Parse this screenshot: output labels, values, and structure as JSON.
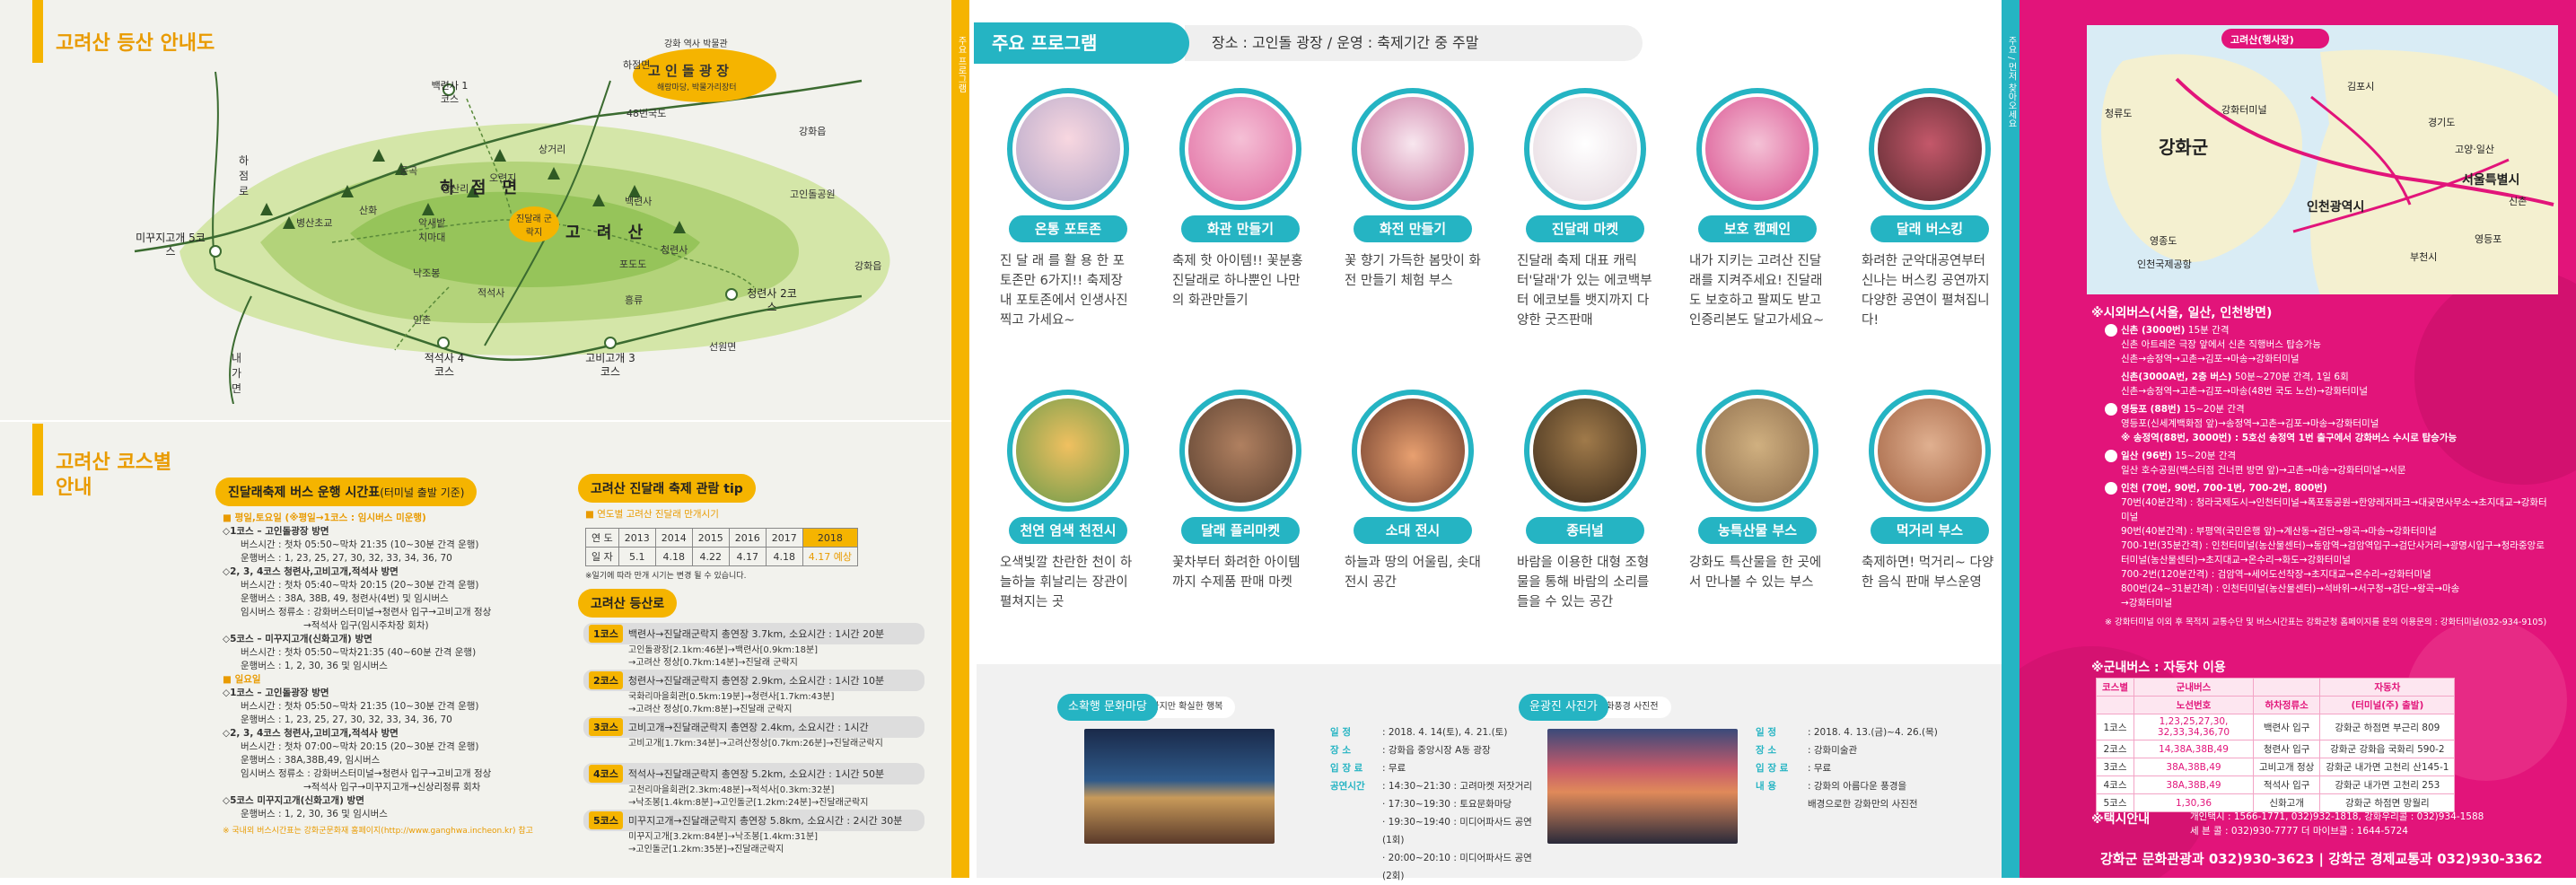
{
  "panel1": {
    "map_title": "고려산 등산 안내도",
    "course_title_l1": "고려산 코스별",
    "course_title_l2": "안내",
    "park": {
      "title": "고 인 돌  광 장",
      "sub": "해랑마당, 박물가리장터",
      "museum": "강화 역사 박물관"
    },
    "map_labels": {
      "hajeommyeon": "하 점 면",
      "goryeosan": "고 려 산",
      "azalea": "진달래 군락지",
      "hajeomro": "하점로",
      "naega": "내가면",
      "mijigogae": "미꾸지고개 5코스",
      "baengnyeonsa": "백련사 1코스",
      "cheongryeonsa": "청련사 2코스",
      "jeokseoksa": "적석사 4코스",
      "gobigogae": "고비고개 3코스",
      "hoejeongsa": "하점면",
      "r48": "48번국도",
      "ganghwaeup": "강화읍",
      "goinmool": "고인돌공원",
      "gwangwha2": "강화읍",
      "seongwon": "선원면",
      "byeongsan": "병산초교",
      "sanhwa": "산화",
      "muhak": "악새밭",
      "chido": "치마대",
      "nakjo": "낙조봉",
      "inchon": "인촌",
      "jeokseoksa2": "적석사",
      "donggok": "동곡",
      "oryeonji": "오련지",
      "sangsanri": "상산리",
      "sangga": "상거리",
      "baengnyeonsa2": "백련사",
      "cheonryeonsa": "청련사",
      "pojangdo": "포도도",
      "heungnyu": "흥류"
    },
    "bus": {
      "title": "진달래축제 버스 운행 시간표",
      "title_note": "(터미널 출발 기준)",
      "weekday": "■ 평일,토요일 (※평일→1코스 : 임시버스 미운행)",
      "c1_title": "◇1코스 – 고인돌광장 방면",
      "c1_l1": "버스시간 : 첫차 05:50~막차 21:35 (10~30분 간격 운행)",
      "c1_l2": "운행버스 : 1, 23, 25, 27, 30, 32, 33, 34, 36, 70",
      "c234_title": "◇2, 3, 4코스 청련사,고비고개,적석사 방면",
      "c234_l1": "버스시간 : 첫차 05:40~막차 20:15 (20~30분 간격 운행)",
      "c234_l2": "운행버스 : 38A, 38B, 49, 청련사(4번) 및 임시버스",
      "c234_l3": "임시버스 정류소 : 강화버스터미널→청련사 입구→고비고개 정상",
      "c234_l4": "→적석사 입구(임시주차장 회차)",
      "c5_title": "◇5코스 – 미꾸지고개(신화고개) 방면",
      "c5_l1": "버스시간 : 첫차 05:50~막차21:35 (40~60분 간격 운행)",
      "c5_l2": "운행버스 : 1, 2, 30, 36 및 임시버스",
      "sunday": "■ 일요일",
      "s1_title": "◇1코스 – 고인돌광장 방면",
      "s1_l1": "버스시간 : 첫차 05:50~막차 21:35 (10~30분 간격 운행)",
      "s1_l2": "운행버스 : 1, 23, 25, 27, 30, 32, 33, 34, 36, 70",
      "s234_title": "◇2, 3, 4코스 청련사,고비고개,적석사 방면",
      "s234_l1": "버스시간 : 첫차 07:00~막차 20:15 (20~30분 간격 운행)",
      "s234_l2": "운행버스 : 38A,38B,49, 임시버스",
      "s234_l3": "임시버스 정류소 : 강화버스터미널→청련사 입구→고비고개 정상",
      "s234_l4": "→적석사 입구→미꾸지고개→신상리정류 회차",
      "s5_title": "◇5코스 미꾸지고개(신화고개) 방면",
      "s5_l1": "운행버스 : 1, 2, 30, 36 및 임시버스",
      "note": "※ 국내외 버스시간표는 강화군문화재 홈페이지(http://www.ganghwa.incheon.kr) 참고"
    },
    "tip": {
      "title": "고려산 진달래 축제 관람 tip",
      "sub": "■ 연도별 고려산 진달래 만개시기",
      "header": [
        "연 도",
        "2013",
        "2014",
        "2015",
        "2016",
        "2017",
        "2018"
      ],
      "row": [
        "일 자",
        "5.1",
        "4.18",
        "4.22",
        "4.17",
        "4.18",
        "4.17 예상"
      ],
      "note": "※일기에 따라 만개 시기는 변경 될 수 있습니다."
    },
    "hike": {
      "title": "고려산 등산로",
      "courses": [
        {
          "idx": "1코스",
          "head": "백련사→진달래군락지 총연장 3.7km, 소요시간 : 1시간 20분",
          "d1": "고인돌광장[2.1km:46분]→백련사[0.9km:18분]",
          "d2": "→고려산 정상[0.7km:14분]→진달래 군락지"
        },
        {
          "idx": "2코스",
          "head": "청련사→진달래군락지 총연장 2.9km, 소요시간 : 1시간 10분",
          "d1": "국화리마을회관[0.5km:19분]→청련사[1.7km:43분]",
          "d2": "→고려산 정상[0.7km:8분]→진달래 군락지"
        },
        {
          "idx": "3코스",
          "head": "고비고개→진달래군락지 총연장 2.4km, 소요시간 : 1시간",
          "d1": "고비고개[1.7km:34분]→고려산정상[0.7km:26분]→진달래군락지",
          "d2": ""
        },
        {
          "idx": "4코스",
          "head": "적석사→진달래군락지 총연장 5.2km, 소요시간 : 1시간 50분",
          "d1": "고천리마을회관[2.3km:48분]→적석사[0.3km:32분]",
          "d2": "→낙조봉[1.4km:8분]→고인돌군[1.2km:24분]→진달래군락지"
        },
        {
          "idx": "5코스",
          "head": "미꾸지고개→진달래군락지 총연장 5.8km, 소요시간 : 2시간 30분",
          "d1": "미꾸지고개[3.2km:84분]→낙조봉[1.4km:31분]",
          "d2": "→고인돌군[1.2km:35분]→진달래군락지"
        }
      ]
    }
  },
  "panel2": {
    "strip_label": "주요 프로그램",
    "title": "주요 프로그램",
    "sub": "장소 : 고인돌 광장 /  운영 : 축제기간 중 주말",
    "row1": [
      {
        "label": "온통 포토존",
        "desc": "진 달 래 를  활 용 한 포토존만 6가지!! 축제장 내 포토존에서 인생사진 찍고 가세요~"
      },
      {
        "label": "화관 만들기",
        "desc": "축제 핫 아이템!! 꽃분홍 진달래로 하나뿐인 나만의 화관만들기"
      },
      {
        "label": "화전 만들기",
        "desc": "꽃 향기 가득한 봄맛이 화전 만들기 체험 부스"
      },
      {
        "label": "진달래 마켓",
        "desc": "진달래 축제 대표 캐릭터'달래'가 있는 에코백부터 에코보틀 뱃지까지 다양한 굿즈판매"
      },
      {
        "label": "보호 캠페인",
        "desc": "내가 지키는 고려산 진달래를 지켜주세요! 진달래도 보호하고 팔찌도 받고 인증리본도 달고가세요~"
      },
      {
        "label": "달래 버스킹",
        "desc": "화려한 군악대공연부터 신나는 버스킹 공연까지 다양한 공연이 펼쳐집니다!"
      }
    ],
    "row2": [
      {
        "label": "천연 염색 천전시",
        "desc": "오색빛깔 찬란한 천이 하늘하늘 휘날리는 장관이 펼쳐지는 곳"
      },
      {
        "label": "달래 플리마켓",
        "desc": "꽃차부터 화려한 아이템까지 수제품 판매 마켓"
      },
      {
        "label": "소대 전시",
        "desc": "하늘과 땅의 어울림, 솟대 전시 공간"
      },
      {
        "label": "종터널",
        "desc": "바람을 이용한 대형 조형물을 통해 바람의 소리를 들을 수 있는 공간"
      },
      {
        "label": "농특산물 부스",
        "desc": "강화도 특산물을 한 곳에서 만나볼 수 있는 부스"
      },
      {
        "label": "먹거리 부스",
        "desc": "축제하면! 먹거리~ 다양한 음식 판매 부스운영"
      }
    ],
    "event1": {
      "pill": "소확행 문화마당",
      "sub": "소소하지만 확실한 행복",
      "k1": "일    정",
      "v1": ": 2018. 4. 14(토), 4. 21.(토)",
      "k2": "장    소",
      "v2": ": 강화읍 중앙시장 A동 광장",
      "k3": "입 장 료",
      "v3": ": 무료",
      "k4": "공연시간",
      "v4": ": 14:30~21:30 : 고려마켓 저잣거리",
      "v5": "· 17:30~19:30 : 토요문화마당",
      "v6": "· 19:30~19:40 : 미디어파사드 공연 (1회)",
      "v7": "· 20:00~20:10 : 미디어파사드 공연 (2회)"
    },
    "event2": {
      "pill": "윤광진 사진가",
      "sub": "강화풍경 사진전",
      "k1": "일    정",
      "v1": ": 2018. 4. 13.(금)~4. 26.(목)",
      "k2": "장    소",
      "v2": ": 강화미술관",
      "k3": "입 장 료",
      "v3": ": 무료",
      "k4": "내    용",
      "v4": ": 강화의 아름다운 풍경을",
      "v5": "  배경으로한 강화만의 사진전"
    }
  },
  "panel3": {
    "strip_label": "주요 / 먼저 찾아오세요"
  },
  "panel4": {
    "map": {
      "main": "고려산(행사장)",
      "ganghwagun": "강화군",
      "incheon": "인천광역시",
      "seoul": "서울특별시",
      "gimpo": "김포시",
      "gyeonggi": "경기도",
      "goyang": "고양·일산",
      "sinchon": "신촌",
      "bucheon": "부천시",
      "yeongdeungpo": "영등포",
      "incheon_airport": "인천국제공항",
      "yeongjong": "영종도",
      "ganghwa_terminal": "강화터미널",
      "cheongryu": "청류도"
    },
    "city_bus_title": "※시외버스(서울, 일산, 인천방면)",
    "b1_head": "신촌 (3000번)",
    "b1_head_tail": " 15분 간격",
    "b1_l1": "신촌 아트레온 극장 앞에서 신촌 직행버스 탑승가능",
    "b1_l2": "신촌→송정역→고촌→김포→마송→강화터미널",
    "b2_head": "신촌(3000A번, 2층 버스)",
    "b2_head_tail": " 50분~270분 간격, 1일 6회",
    "b2_l1": "신촌→송정역→고촌→김포→마송(48번 국도 노선)→강화터미널",
    "b3_head": "영등포 (88번)",
    "b3_head_tail": " 15~20분 간격",
    "b3_l1": "영등포(신세계백화점 앞)→송정역→고촌→김포→마송→강화터미널",
    "b3_l2": "※ 송정역(88번, 3000번) : 5호선 송정역 1번 출구에서 강화버스 수시로 탑승가능",
    "b4_head": "일산 (96번)",
    "b4_head_tail": " 15~20분 간격",
    "b4_l1": "일산 호수공원(백스터점 건너편 방면 앞)→고촌→마송→강화터미널→서문",
    "b5_head": "인천 (70번, 90번, 700-1번, 700-2번, 800번)",
    "b5_l1": "70번(40분간격) : 청라국제도시→인천터미널→폭포동공원→한양레저파크→대곶면사무소→초지대교→강화터미널",
    "b5_l2": "90번(40분간격) : 부평역(국민은행 앞)→계산동→검단→왕곡→마송→강화터미널",
    "b5_l3": "700-1번(35분간격) : 인천터미널(농산물센터)→동암역→검암역입구→검단사거리→광명시입구→청라중앙로",
    "b5_l4": "터미널(농산물센터)→초지대교→온수리→화도→강화터미널",
    "b5_l5": "700-2번(120분간격) : 검암역→세어도선착장→초지대교→온수리→강화터미널",
    "b5_l6": "800번(24~31분간격) : 인천터미널(농산물센터)→석바위→서구청→검단→왕곡→마송",
    "b5_l7": "→강화터미널",
    "b_note": "※ 강화터미널 이외 후 목적지 교통수단 및 버스시간표는 강화군청 홈페이지를 문의 이용문의 : 강화터미널(032-934-9105)",
    "local_title": "※군내버스 : 자동차 이용",
    "table": {
      "h1": [
        "코스별",
        "군내버스",
        "",
        "자동차"
      ],
      "h2": [
        "",
        "노선번호",
        "하차정류소",
        "(터미널(주) 출발)"
      ],
      "rows": [
        [
          "1코스",
          "1,23,25,27,30, 32,33,34,36,70",
          "백련사 입구",
          "강화군 하점면 부근리 809"
        ],
        [
          "2코스",
          "14,38A,38B,49",
          "청련사 입구",
          "강화군 강화읍 국화리 590-2"
        ],
        [
          "3코스",
          "38A,38B,49",
          "고비고개 정상",
          "강화군 내가면 고천리 산145-1"
        ],
        [
          "4코스",
          "38A,38B,49",
          "적석사 입구",
          "강화군 내가면 고천리 253"
        ],
        [
          "5코스",
          "1,30,36",
          "신화고개",
          "강화군 하점면 망월리"
        ]
      ]
    },
    "taxi_title": "※택시안내",
    "taxi_l1": "개인택시 : 1566-1771, 032)932-1818, 강화우리콜 : 032)934-1588",
    "taxi_l2": "세 븐 콜 : 032)930-7777  더 마이브콜 : 1644-5724",
    "footer": "강화군 문화관광과 032)930-3623  |  강화군 경제교통과 032)930-3362"
  }
}
